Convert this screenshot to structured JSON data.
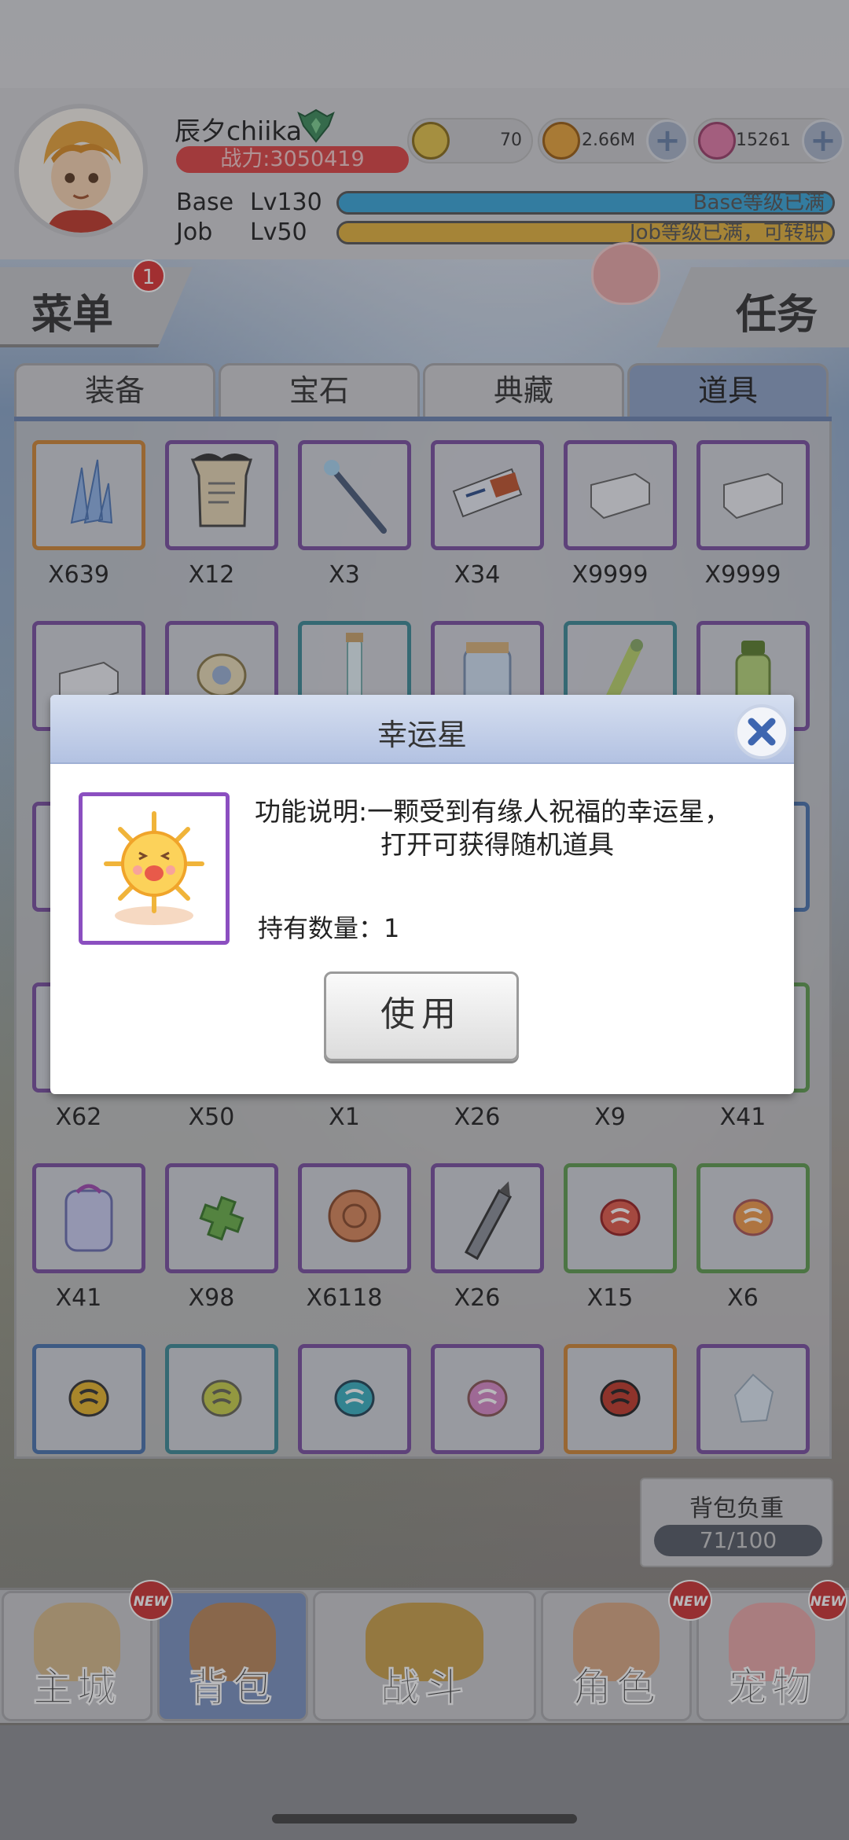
{
  "player": {
    "name": "辰夕chiika",
    "power": "战力:3050419"
  },
  "currencies": [
    {
      "icon": "zeny-coin-icon",
      "value": "70"
    },
    {
      "icon": "gold-coin-icon",
      "value": "2.66M"
    },
    {
      "icon": "pink-gem-icon",
      "value": "15261"
    }
  ],
  "levels": {
    "base_label": "Base",
    "base_level": "Lv130",
    "base_text": "Base等级已满",
    "base_color": "#3aa6d8",
    "job_label": "Job",
    "job_level": "Lv50",
    "job_text": "Job等级已满，可转职",
    "job_color": "#e3b23c"
  },
  "menu": {
    "label": "菜单",
    "badge": "1"
  },
  "task": {
    "label": "任务"
  },
  "tabs": [
    {
      "label": "装备",
      "active": false
    },
    {
      "label": "宝石",
      "active": false
    },
    {
      "label": "典藏",
      "active": false
    },
    {
      "label": "道具",
      "active": true
    }
  ],
  "inventory_rows": [
    [
      "X639",
      "X12",
      "X3",
      "X34",
      "X9999",
      "X9999"
    ],
    [
      "",
      "",
      "",
      "",
      "",
      ""
    ],
    [
      "",
      "",
      "",
      "",
      "",
      ""
    ],
    [
      "X62",
      "X50",
      "X1",
      "X26",
      "X9",
      "X41"
    ],
    [
      "X41",
      "X98",
      "X6118",
      "X26",
      "X15",
      "X6"
    ],
    [
      "",
      "",
      "",
      "",
      "",
      ""
    ]
  ],
  "bag_weight": {
    "label": "背包负重",
    "value": "71/100"
  },
  "nav": [
    {
      "label": "主城",
      "new": "NEW",
      "active": false
    },
    {
      "label": "背包",
      "new": "",
      "active": true
    },
    {
      "label": "战斗",
      "new": "",
      "active": false
    },
    {
      "label": "角色",
      "new": "NEW",
      "active": false
    },
    {
      "label": "宠物",
      "new": "NEW",
      "active": false
    }
  ],
  "dialog": {
    "title": "幸运星",
    "item_icon": "lucky-star-sun-icon",
    "desc_line1": "功能说明:一颗受到有缘人祝福的幸运星，",
    "desc_line2": "打开可获得随机道具",
    "hold_label": "持有数量：",
    "hold_value": "1",
    "use_label": "使用"
  }
}
